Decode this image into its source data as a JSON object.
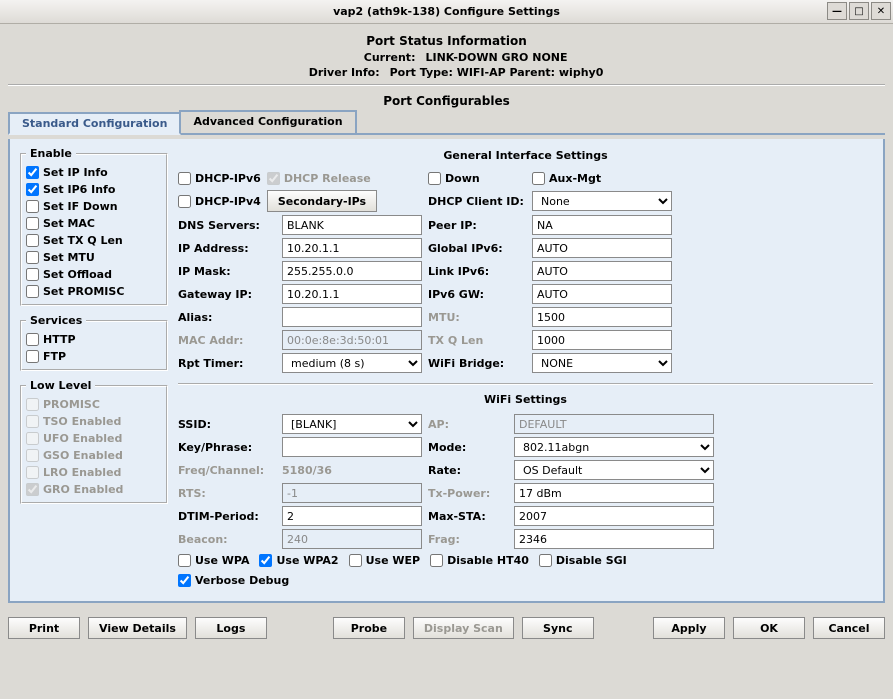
{
  "window": {
    "title": "vap2  (ath9k-138) Configure Settings"
  },
  "status": {
    "section": "Port Status Information",
    "current_lbl": "Current:",
    "current_val": "LINK-DOWN GRO  NONE",
    "driver_lbl": "Driver Info:",
    "driver_val": "Port Type: WIFI-AP   Parent: wiphy0"
  },
  "config": {
    "section": "Port Configurables",
    "tabs": {
      "standard": "Standard Configuration",
      "advanced": "Advanced Configuration"
    }
  },
  "enable": {
    "legend": "Enable",
    "items": [
      {
        "label": "Set IP Info",
        "checked": true
      },
      {
        "label": "Set IP6 Info",
        "checked": true
      },
      {
        "label": "Set IF Down",
        "checked": false
      },
      {
        "label": "Set MAC",
        "checked": false
      },
      {
        "label": "Set TX Q Len",
        "checked": false
      },
      {
        "label": "Set MTU",
        "checked": false
      },
      {
        "label": "Set Offload",
        "checked": false
      },
      {
        "label": "Set PROMISC",
        "checked": false
      }
    ]
  },
  "services": {
    "legend": "Services",
    "items": [
      {
        "label": "HTTP",
        "checked": false
      },
      {
        "label": "FTP",
        "checked": false
      }
    ]
  },
  "lowlevel": {
    "legend": "Low Level",
    "items": [
      {
        "label": "PROMISC",
        "checked": false
      },
      {
        "label": "TSO Enabled",
        "checked": false
      },
      {
        "label": "UFO Enabled",
        "checked": false
      },
      {
        "label": "GSO Enabled",
        "checked": false
      },
      {
        "label": "LRO Enabled",
        "checked": false
      },
      {
        "label": "GRO Enabled",
        "checked": true
      }
    ]
  },
  "general": {
    "title": "General Interface Settings",
    "dhcp_ipv6": "DHCP-IPv6",
    "dhcp_release": "DHCP Release",
    "down": "Down",
    "aux_mgt": "Aux-Mgt",
    "dhcp_ipv4": "DHCP-IPv4",
    "secondary_ips": "Secondary-IPs",
    "dhcp_client_id_lbl": "DHCP Client ID:",
    "dhcp_client_id": "None",
    "dns_lbl": "DNS Servers:",
    "dns": "BLANK",
    "peer_lbl": "Peer IP:",
    "peer": "NA",
    "ip_lbl": "IP Address:",
    "ip": "10.20.1.1",
    "gipv6_lbl": "Global IPv6:",
    "gipv6": "AUTO",
    "mask_lbl": "IP Mask:",
    "mask": "255.255.0.0",
    "lipv6_lbl": "Link IPv6:",
    "lipv6": "AUTO",
    "gw_lbl": "Gateway IP:",
    "gw": "10.20.1.1",
    "ipv6gw_lbl": "IPv6 GW:",
    "ipv6gw": "AUTO",
    "alias_lbl": "Alias:",
    "alias": "",
    "mtu_lbl": "MTU:",
    "mtu": "1500",
    "mac_lbl": "MAC Addr:",
    "mac": "00:0e:8e:3d:50:01",
    "txq_lbl": "TX Q Len",
    "txq": "1000",
    "rpt_lbl": "Rpt Timer:",
    "rpt": "medium  (8 s)",
    "bridge_lbl": "WiFi Bridge:",
    "bridge": "NONE"
  },
  "wifi": {
    "title": "WiFi Settings",
    "ssid_lbl": "SSID:",
    "ssid": "[BLANK]",
    "ap_lbl": "AP:",
    "ap": "DEFAULT",
    "key_lbl": "Key/Phrase:",
    "key": "",
    "mode_lbl": "Mode:",
    "mode": "802.11abgn",
    "freq_lbl": "Freq/Channel:",
    "freq": "5180/36",
    "rate_lbl": "Rate:",
    "rate": "OS Default",
    "rts_lbl": "RTS:",
    "rts": "-1",
    "txp_lbl": "Tx-Power:",
    "txp": "17 dBm",
    "dtim_lbl": "DTIM-Period:",
    "dtim": "2",
    "maxsta_lbl": "Max-STA:",
    "maxsta": "2007",
    "beacon_lbl": "Beacon:",
    "beacon": "240",
    "frag_lbl": "Frag:",
    "frag": "2346",
    "use_wpa": "Use WPA",
    "use_wpa2": "Use WPA2",
    "use_wep": "Use WEP",
    "dis_ht40": "Disable HT40",
    "dis_sgi": "Disable SGI",
    "verbose": "Verbose Debug"
  },
  "buttons": {
    "print": "Print",
    "view_details": "View Details",
    "logs": "Logs",
    "probe": "Probe",
    "display_scan": "Display Scan",
    "sync": "Sync",
    "apply": "Apply",
    "ok": "OK",
    "cancel": "Cancel"
  }
}
